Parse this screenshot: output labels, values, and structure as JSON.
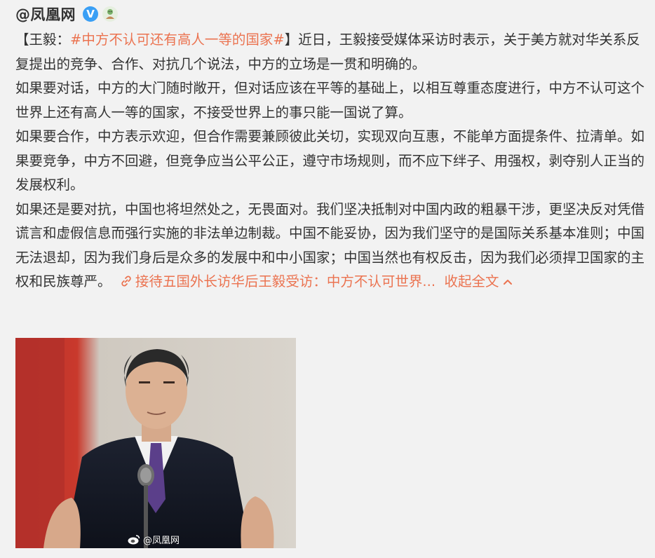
{
  "post": {
    "author": "@凤凰网",
    "verified_icon": "verified-v-icon",
    "member_icon": "member-avatar-icon",
    "text": {
      "open_bracket": "【王毅：",
      "topic": "#中方不认可还有高人一等的国家#",
      "p1_rest": "】近日，王毅接受媒体采访时表示，关于美方就对华关系反复提出的竞争、合作、对抗几个说法，中方的立场是一贯和明确的。",
      "p2": "如果要对话，中方的大门随时敞开，但对话应该在平等的基础上，以相互尊重态度进行，中方不认可这个世界上还有高人一等的国家，不接受世界上的事只能一国说了算。",
      "p3": "如果要合作，中方表示欢迎，但合作需要兼顾彼此关切，实现双向互惠，不能单方面提条件、拉清单。如果要竞争，中方不回避，但竞争应当公平公正，遵守市场规则，而不应下绊子、用强权，剥夺别人正当的发展权利。",
      "p4": "如果还是要对抗，中国也将坦然处之，无畏面对。我们坚决抵制对中国内政的粗暴干涉，更坚决反对凭借谎言和虚假信息而强行实施的非法单边制裁。中国不能妥协，因为我们坚守的是国际关系基本准则；中国无法退却，因为我们身后是众多的发展中和中小国家；中国当然也有权反击，因为我们必须捍卫国家的主权和民族尊严。",
      "link_text": "接待五国外长访华后王毅受访：中方不认可世界...",
      "collapse_label": "收起全文"
    },
    "image": {
      "watermark": "@凤凰网"
    }
  },
  "colors": {
    "accent": "#eb7350",
    "text": "#333333",
    "verified": "#3a9ff5",
    "background": "#f2f2f2"
  }
}
